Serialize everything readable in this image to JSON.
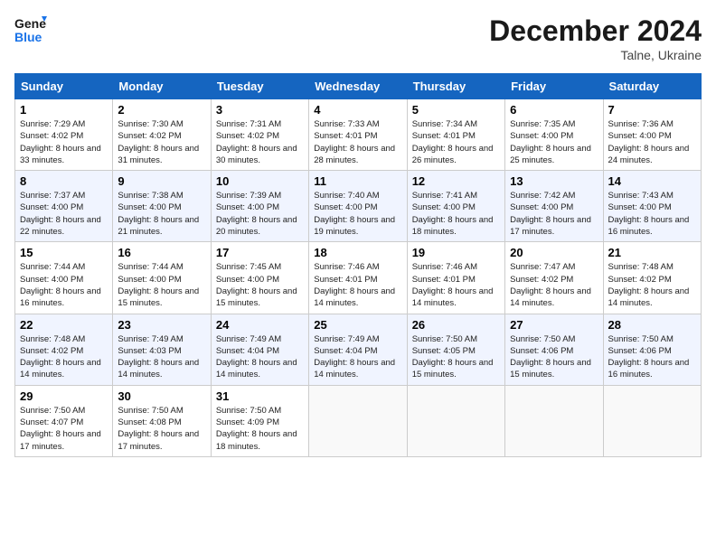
{
  "header": {
    "logo_line1": "General",
    "logo_line2": "Blue",
    "month_title": "December 2024",
    "subtitle": "Talne, Ukraine"
  },
  "weekdays": [
    "Sunday",
    "Monday",
    "Tuesday",
    "Wednesday",
    "Thursday",
    "Friday",
    "Saturday"
  ],
  "weeks": [
    [
      {
        "day": "1",
        "sunrise": "7:29 AM",
        "sunset": "4:02 PM",
        "daylight": "8 hours and 33 minutes."
      },
      {
        "day": "2",
        "sunrise": "7:30 AM",
        "sunset": "4:02 PM",
        "daylight": "8 hours and 31 minutes."
      },
      {
        "day": "3",
        "sunrise": "7:31 AM",
        "sunset": "4:02 PM",
        "daylight": "8 hours and 30 minutes."
      },
      {
        "day": "4",
        "sunrise": "7:33 AM",
        "sunset": "4:01 PM",
        "daylight": "8 hours and 28 minutes."
      },
      {
        "day": "5",
        "sunrise": "7:34 AM",
        "sunset": "4:01 PM",
        "daylight": "8 hours and 26 minutes."
      },
      {
        "day": "6",
        "sunrise": "7:35 AM",
        "sunset": "4:00 PM",
        "daylight": "8 hours and 25 minutes."
      },
      {
        "day": "7",
        "sunrise": "7:36 AM",
        "sunset": "4:00 PM",
        "daylight": "8 hours and 24 minutes."
      }
    ],
    [
      {
        "day": "8",
        "sunrise": "7:37 AM",
        "sunset": "4:00 PM",
        "daylight": "8 hours and 22 minutes."
      },
      {
        "day": "9",
        "sunrise": "7:38 AM",
        "sunset": "4:00 PM",
        "daylight": "8 hours and 21 minutes."
      },
      {
        "day": "10",
        "sunrise": "7:39 AM",
        "sunset": "4:00 PM",
        "daylight": "8 hours and 20 minutes."
      },
      {
        "day": "11",
        "sunrise": "7:40 AM",
        "sunset": "4:00 PM",
        "daylight": "8 hours and 19 minutes."
      },
      {
        "day": "12",
        "sunrise": "7:41 AM",
        "sunset": "4:00 PM",
        "daylight": "8 hours and 18 minutes."
      },
      {
        "day": "13",
        "sunrise": "7:42 AM",
        "sunset": "4:00 PM",
        "daylight": "8 hours and 17 minutes."
      },
      {
        "day": "14",
        "sunrise": "7:43 AM",
        "sunset": "4:00 PM",
        "daylight": "8 hours and 16 minutes."
      }
    ],
    [
      {
        "day": "15",
        "sunrise": "7:44 AM",
        "sunset": "4:00 PM",
        "daylight": "8 hours and 16 minutes."
      },
      {
        "day": "16",
        "sunrise": "7:44 AM",
        "sunset": "4:00 PM",
        "daylight": "8 hours and 15 minutes."
      },
      {
        "day": "17",
        "sunrise": "7:45 AM",
        "sunset": "4:00 PM",
        "daylight": "8 hours and 15 minutes."
      },
      {
        "day": "18",
        "sunrise": "7:46 AM",
        "sunset": "4:01 PM",
        "daylight": "8 hours and 14 minutes."
      },
      {
        "day": "19",
        "sunrise": "7:46 AM",
        "sunset": "4:01 PM",
        "daylight": "8 hours and 14 minutes."
      },
      {
        "day": "20",
        "sunrise": "7:47 AM",
        "sunset": "4:02 PM",
        "daylight": "8 hours and 14 minutes."
      },
      {
        "day": "21",
        "sunrise": "7:48 AM",
        "sunset": "4:02 PM",
        "daylight": "8 hours and 14 minutes."
      }
    ],
    [
      {
        "day": "22",
        "sunrise": "7:48 AM",
        "sunset": "4:02 PM",
        "daylight": "8 hours and 14 minutes."
      },
      {
        "day": "23",
        "sunrise": "7:49 AM",
        "sunset": "4:03 PM",
        "daylight": "8 hours and 14 minutes."
      },
      {
        "day": "24",
        "sunrise": "7:49 AM",
        "sunset": "4:04 PM",
        "daylight": "8 hours and 14 minutes."
      },
      {
        "day": "25",
        "sunrise": "7:49 AM",
        "sunset": "4:04 PM",
        "daylight": "8 hours and 14 minutes."
      },
      {
        "day": "26",
        "sunrise": "7:50 AM",
        "sunset": "4:05 PM",
        "daylight": "8 hours and 15 minutes."
      },
      {
        "day": "27",
        "sunrise": "7:50 AM",
        "sunset": "4:06 PM",
        "daylight": "8 hours and 15 minutes."
      },
      {
        "day": "28",
        "sunrise": "7:50 AM",
        "sunset": "4:06 PM",
        "daylight": "8 hours and 16 minutes."
      }
    ],
    [
      {
        "day": "29",
        "sunrise": "7:50 AM",
        "sunset": "4:07 PM",
        "daylight": "8 hours and 17 minutes."
      },
      {
        "day": "30",
        "sunrise": "7:50 AM",
        "sunset": "4:08 PM",
        "daylight": "8 hours and 17 minutes."
      },
      {
        "day": "31",
        "sunrise": "7:50 AM",
        "sunset": "4:09 PM",
        "daylight": "8 hours and 18 minutes."
      },
      null,
      null,
      null,
      null
    ]
  ]
}
